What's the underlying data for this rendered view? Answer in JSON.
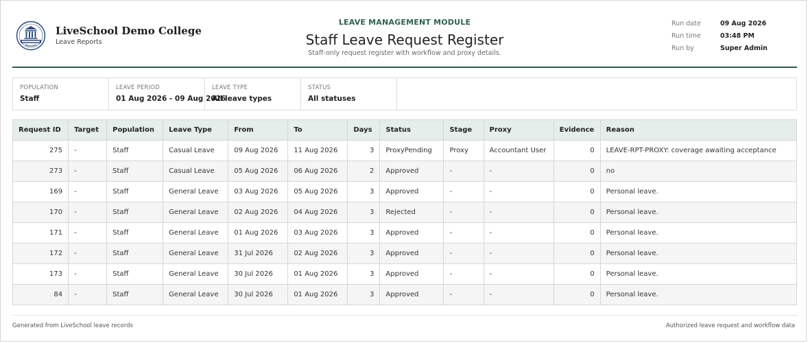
{
  "header": {
    "college_name": "LiveSchool Demo College",
    "college_sub": "Leave Reports",
    "module": "LEAVE MANAGEMENT MODULE",
    "title": "Staff Leave Request Register",
    "subtitle": "Staff-only request register with workflow and proxy details.",
    "logo_icon": "school-crest-icon",
    "run": [
      {
        "label": "Run date",
        "value": "09 Aug 2026"
      },
      {
        "label": "Run time",
        "value": "03:48 PM"
      },
      {
        "label": "Run by",
        "value": "Super Admin"
      }
    ]
  },
  "filters": [
    {
      "label": "Population",
      "value": "Staff"
    },
    {
      "label": "Leave Period",
      "value": "01 Aug 2026 - 09 Aug 2026"
    },
    {
      "label": "Leave Type",
      "value": "All leave types"
    },
    {
      "label": "Status",
      "value": "All statuses"
    }
  ],
  "table": {
    "columns": [
      "Request ID",
      "Target",
      "Population",
      "Leave Type",
      "From",
      "To",
      "Days",
      "Status",
      "Stage",
      "Proxy",
      "Evidence",
      "Reason"
    ],
    "rows": [
      [
        "275",
        "-",
        "Staff",
        "Casual Leave",
        "09 Aug 2026",
        "11 Aug 2026",
        "3",
        "ProxyPending",
        "Proxy",
        "Accountant User",
        "0",
        "LEAVE-RPT-PROXY: coverage awaiting acceptance"
      ],
      [
        "273",
        "-",
        "Staff",
        "Casual Leave",
        "05 Aug 2026",
        "06 Aug 2026",
        "2",
        "Approved",
        "-",
        "-",
        "0",
        "no"
      ],
      [
        "169",
        "-",
        "Staff",
        "General Leave",
        "03 Aug 2026",
        "05 Aug 2026",
        "3",
        "Approved",
        "-",
        "-",
        "0",
        "Personal leave."
      ],
      [
        "170",
        "-",
        "Staff",
        "General Leave",
        "02 Aug 2026",
        "04 Aug 2026",
        "3",
        "Rejected",
        "-",
        "-",
        "0",
        "Personal leave."
      ],
      [
        "171",
        "-",
        "Staff",
        "General Leave",
        "01 Aug 2026",
        "03 Aug 2026",
        "3",
        "Approved",
        "-",
        "-",
        "0",
        "Personal leave."
      ],
      [
        "172",
        "-",
        "Staff",
        "General Leave",
        "31 Jul 2026",
        "02 Aug 2026",
        "3",
        "Approved",
        "-",
        "-",
        "0",
        "Personal leave."
      ],
      [
        "173",
        "-",
        "Staff",
        "General Leave",
        "30 Jul 2026",
        "01 Aug 2026",
        "3",
        "Approved",
        "-",
        "-",
        "0",
        "Personal leave."
      ],
      [
        "84",
        "-",
        "Staff",
        "General Leave",
        "30 Jul 2026",
        "01 Aug 2026",
        "3",
        "Approved",
        "-",
        "-",
        "0",
        "Personal leave."
      ]
    ]
  },
  "footer": {
    "left": "Generated from LiveSchool leave records",
    "right": "Authorized leave request and workflow data"
  },
  "colors": {
    "accent": "#2f5b4f",
    "header_fill": "#e5eeea",
    "logo_blue": "#2e4c7d"
  }
}
